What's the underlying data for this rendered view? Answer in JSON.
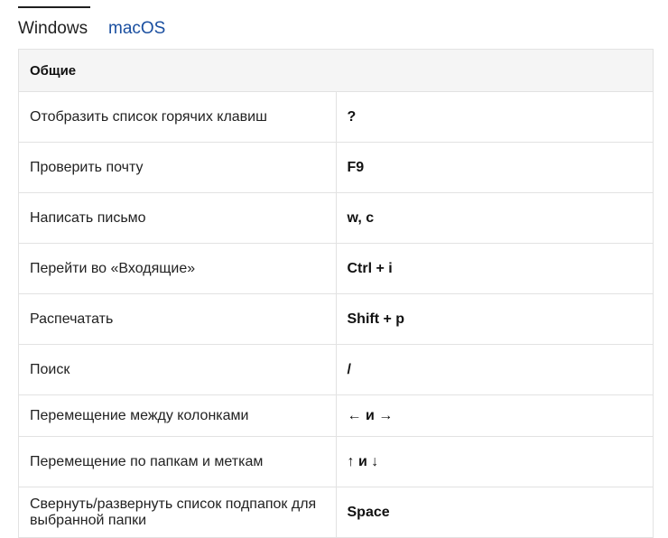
{
  "tabs": [
    {
      "label": "Windows",
      "active": true
    },
    {
      "label": "macOS",
      "active": false
    }
  ],
  "table": {
    "group_title": "Общие",
    "rows": [
      {
        "action": "Отобразить список горячих клавиш",
        "keys": "?"
      },
      {
        "action": "Проверить почту",
        "keys": "F9"
      },
      {
        "action": "Написать письмо",
        "keys": "w, c"
      },
      {
        "action": "Перейти во «Входящие»",
        "keys": "Ctrl + i"
      },
      {
        "action": "Распечатать",
        "keys": "Shift + p"
      },
      {
        "action": "Поиск",
        "keys": "/"
      },
      {
        "action": "Перемещение между колонками",
        "keys": "← и →"
      },
      {
        "action": "Перемещение по папкам и меткам",
        "keys": "↑ и ↓"
      },
      {
        "action": "Свернуть/развернуть список подпапок для выбранной папки",
        "keys": "Space"
      }
    ]
  },
  "colors": {
    "link": "#1a4fa0",
    "border": "#e2e2e2",
    "header_bg": "#f5f5f5"
  }
}
